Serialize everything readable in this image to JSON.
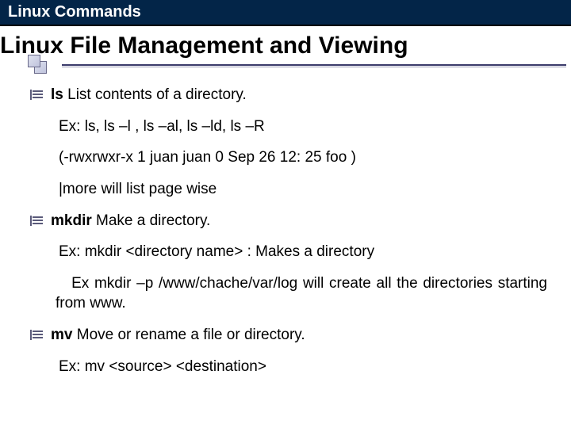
{
  "header": {
    "title": "Linux Commands"
  },
  "main": {
    "title": "Linux File Management and Viewing"
  },
  "body": {
    "ls": {
      "cmd": "ls",
      "desc": " List contents of a directory.",
      "ex1": "Ex: ls, ls –l , ls –al, ls –ld, ls –R",
      "ex2": "(-rwxrwxr-x 1 juan juan 0 Sep 26 12: 25 foo )",
      "ex3": "|more will list page wise"
    },
    "mkdir": {
      "cmd": "mkdir",
      "desc": " Make a directory.",
      "ex1": "Ex: mkdir <directory name> : Makes a directory",
      "ex2": "   Ex mkdir –p /www/chache/var/log will create all the directories starting from www."
    },
    "mv": {
      "cmd": "mv",
      "desc": " Move or rename a file or directory.",
      "ex1": "Ex: mv <source> <destination>"
    }
  }
}
